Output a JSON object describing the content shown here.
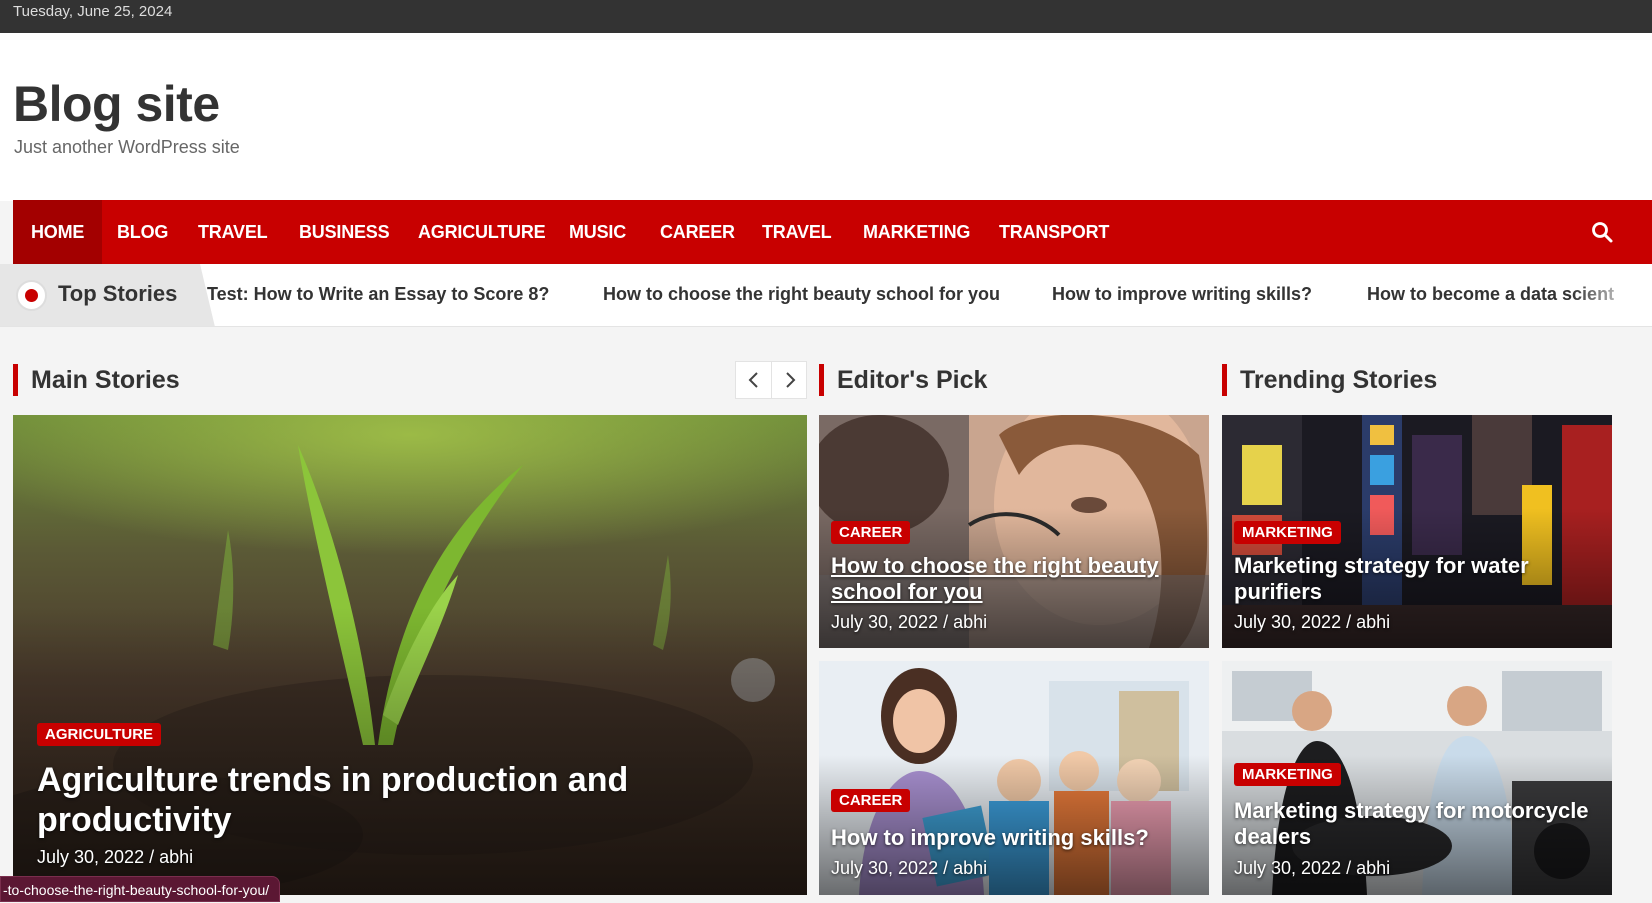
{
  "topbar": {
    "date": "Tuesday, June 25, 2024"
  },
  "site": {
    "title": "Blog site",
    "description": "Just another WordPress site"
  },
  "nav": {
    "items": [
      "HOME",
      "BLOG",
      "TRAVEL",
      "BUSINESS",
      "AGRICULTURE",
      "MUSIC",
      "CAREER",
      "TRAVEL",
      "MARKETING",
      "TRANSPORT"
    ],
    "icon": "search-icon"
  },
  "ticker": {
    "label": "Top Stories",
    "items": [
      "Test: How to Write an Essay to Score 8?",
      "How to choose the right beauty school for you",
      "How to improve writing skills?",
      "How to become a data scient"
    ]
  },
  "sections": {
    "main": "Main Stories",
    "editors": "Editor's Pick",
    "trending": "Trending Stories"
  },
  "main_story": {
    "category": "AGRICULTURE",
    "title": "Agriculture trends in production and productivity",
    "meta": "July 30, 2022 / abhi"
  },
  "editors_pick": [
    {
      "category": "CAREER",
      "title": "How to choose the right beauty school for you",
      "meta": "July 30, 2022 / abhi"
    },
    {
      "category": "CAREER",
      "title": "How to improve writing skills?",
      "meta": "July 30, 2022 / abhi"
    }
  ],
  "trending": [
    {
      "category": "MARKETING",
      "title": "Marketing strategy for water purifiers",
      "meta": "July 30, 2022 / abhi"
    },
    {
      "category": "MARKETING",
      "title": "Marketing strategy for motorcycle dealers",
      "meta": "July 30, 2022 / abhi"
    }
  ],
  "status_url": "-to-choose-the-right-beauty-school-for-you/",
  "colors": {
    "accent": "#c80000",
    "topbar": "#333333"
  }
}
